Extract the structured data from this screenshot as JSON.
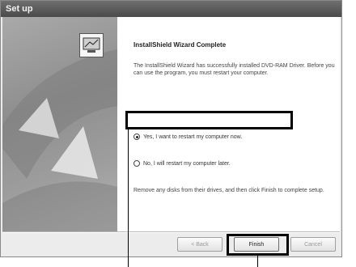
{
  "window": {
    "title": "Set up"
  },
  "wizard": {
    "heading": "InstallShield Wizard Complete",
    "intro": "The InstallShield Wizard has successfully installed DVD-RAM Driver. Before you can use the program, you must restart your computer.",
    "options": [
      {
        "label": "Yes, I want to restart my computer now.",
        "selected": true
      },
      {
        "label": "No, I will restart my computer later.",
        "selected": false
      }
    ],
    "note": "Remove any disks from their drives, and then click Finish to complete setup."
  },
  "buttons": {
    "back": "< Back",
    "finish": "Finish",
    "cancel": "Cancel"
  },
  "icons": {
    "logo": "installshield-computer-icon"
  }
}
